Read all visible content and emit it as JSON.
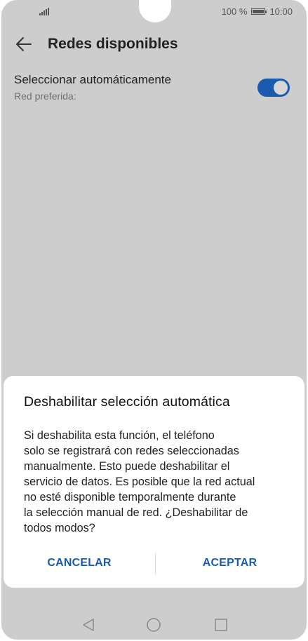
{
  "status_bar": {
    "battery_text": "100 %",
    "time": "10:00"
  },
  "app_bar": {
    "title": "Redes disponibles",
    "back_icon": "arrow-left-icon"
  },
  "setting": {
    "title": "Seleccionar automáticamente",
    "subtitle": "Red preferida:",
    "toggle_on": true,
    "toggle_color": "#1a5bb0"
  },
  "dialog": {
    "title": "Deshabilitar selección automática",
    "body": "Si deshabilita esta función, el teléfono\nsolo se registrará con redes seleccionadas\nmanualmente. Esto puede deshabilitar el\nservicio de datos. Es posible que la red actual\nno esté disponible temporalmente durante\nla selección manual de red. ¿Deshabilitar de\ntodos modos?",
    "cancel_label": "CANCELAR",
    "accept_label": "ACEPTAR"
  },
  "nav_bar": {
    "icons": [
      "triangle-back-icon",
      "circle-home-icon",
      "square-recent-icon"
    ]
  },
  "colors": {
    "accent": "#1a5bb0",
    "overlay_background": "#cdcdcd",
    "dialog_background": "#ffffff"
  }
}
